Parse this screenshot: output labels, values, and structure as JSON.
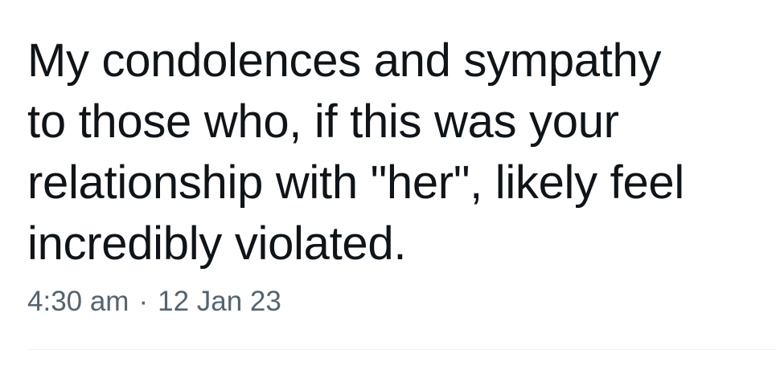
{
  "tweet": {
    "text": "My condolences and sympathy\nto those who, if this was your\nrelationship with \"her\", likely feel\nincredibly violated.",
    "time": "4:30 am",
    "separator": "·",
    "date": "12 Jan 23"
  },
  "colors": {
    "text": "#0f1419",
    "meta": "#536471",
    "divider": "#eff3f4",
    "background": "#ffffff"
  }
}
